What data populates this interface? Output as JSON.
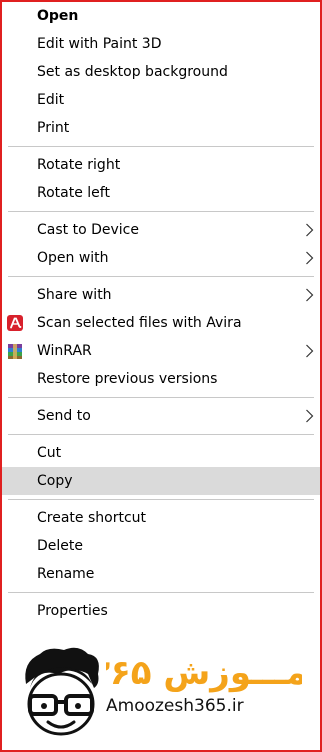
{
  "menu": {
    "open": "Open",
    "edit_paint3d": "Edit with Paint 3D",
    "set_desktop_bg": "Set as desktop background",
    "edit": "Edit",
    "print": "Print",
    "rotate_right": "Rotate right",
    "rotate_left": "Rotate left",
    "cast_to_device": "Cast to Device",
    "open_with": "Open with",
    "share_with": "Share with",
    "scan_avira": "Scan selected files with Avira",
    "winrar": "WinRAR",
    "restore_versions": "Restore previous versions",
    "send_to": "Send to",
    "cut": "Cut",
    "copy": "Copy",
    "create_shortcut": "Create shortcut",
    "delete": "Delete",
    "rename": "Rename",
    "properties": "Properties"
  },
  "watermark": {
    "persian_text": "آمـــوزش ۳۶۵",
    "url": "Amoozesh365.ir"
  },
  "colors": {
    "frame": "#e02020",
    "hover": "#dadada",
    "separator": "#c8c8c8",
    "avira": "#d8212c",
    "logo_orange": "#f4a31a"
  },
  "icons": {
    "avira": "avira-icon",
    "winrar": "winrar-icon",
    "submenu": "chevron-right-icon"
  }
}
